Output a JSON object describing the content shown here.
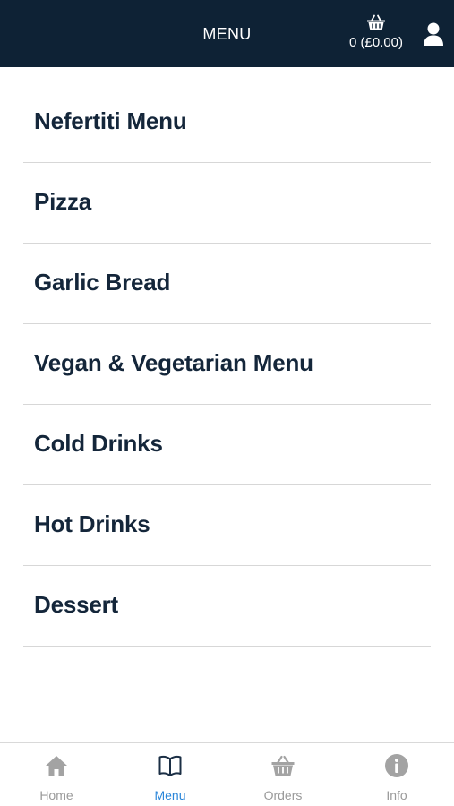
{
  "header": {
    "title": "MENU",
    "cart_summary": "0 (£0.00)",
    "cart_icon": "basket-icon",
    "user_icon": "user-icon"
  },
  "menu": {
    "items": [
      {
        "label": "Nefertiti Menu"
      },
      {
        "label": "Pizza"
      },
      {
        "label": "Garlic Bread"
      },
      {
        "label": "Vegan & Vegetarian Menu"
      },
      {
        "label": "Cold Drinks"
      },
      {
        "label": "Hot Drinks"
      },
      {
        "label": "Dessert"
      }
    ]
  },
  "tabbar": {
    "active": "Menu",
    "active_color": "#2b86d9",
    "inactive_color": "#9a9a9a",
    "tabs": [
      {
        "label": "Home",
        "icon": "home-icon"
      },
      {
        "label": "Menu",
        "icon": "book-icon"
      },
      {
        "label": "Orders",
        "icon": "basket-icon"
      },
      {
        "label": "Info",
        "icon": "info-icon"
      }
    ]
  },
  "colors": {
    "header_bg": "#0e2235",
    "item_text": "#14263a",
    "divider": "#d7d7d7"
  }
}
